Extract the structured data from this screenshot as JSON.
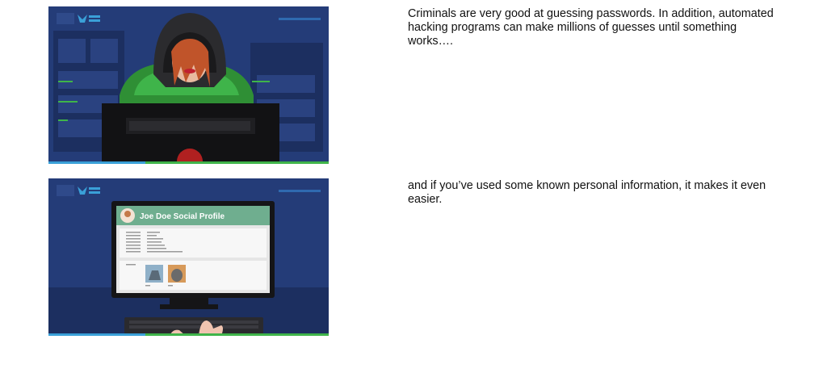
{
  "slides": [
    {
      "scene": "hacker-at-computer",
      "note": "Criminals are very good at guessing passwords. In addition, automated hacking programs can make millions of guesses until something works…."
    },
    {
      "scene": "social-profile-on-monitor",
      "profile_title": "Joe Doe Social Profile",
      "note": "and if you’ve used some known personal information, it makes it even easier."
    }
  ],
  "colors": {
    "slide_bg": "#243c78",
    "accent_green": "#3fb44a",
    "accent_blue": "#3aa0d8",
    "profile_header": "#6fae8f"
  }
}
